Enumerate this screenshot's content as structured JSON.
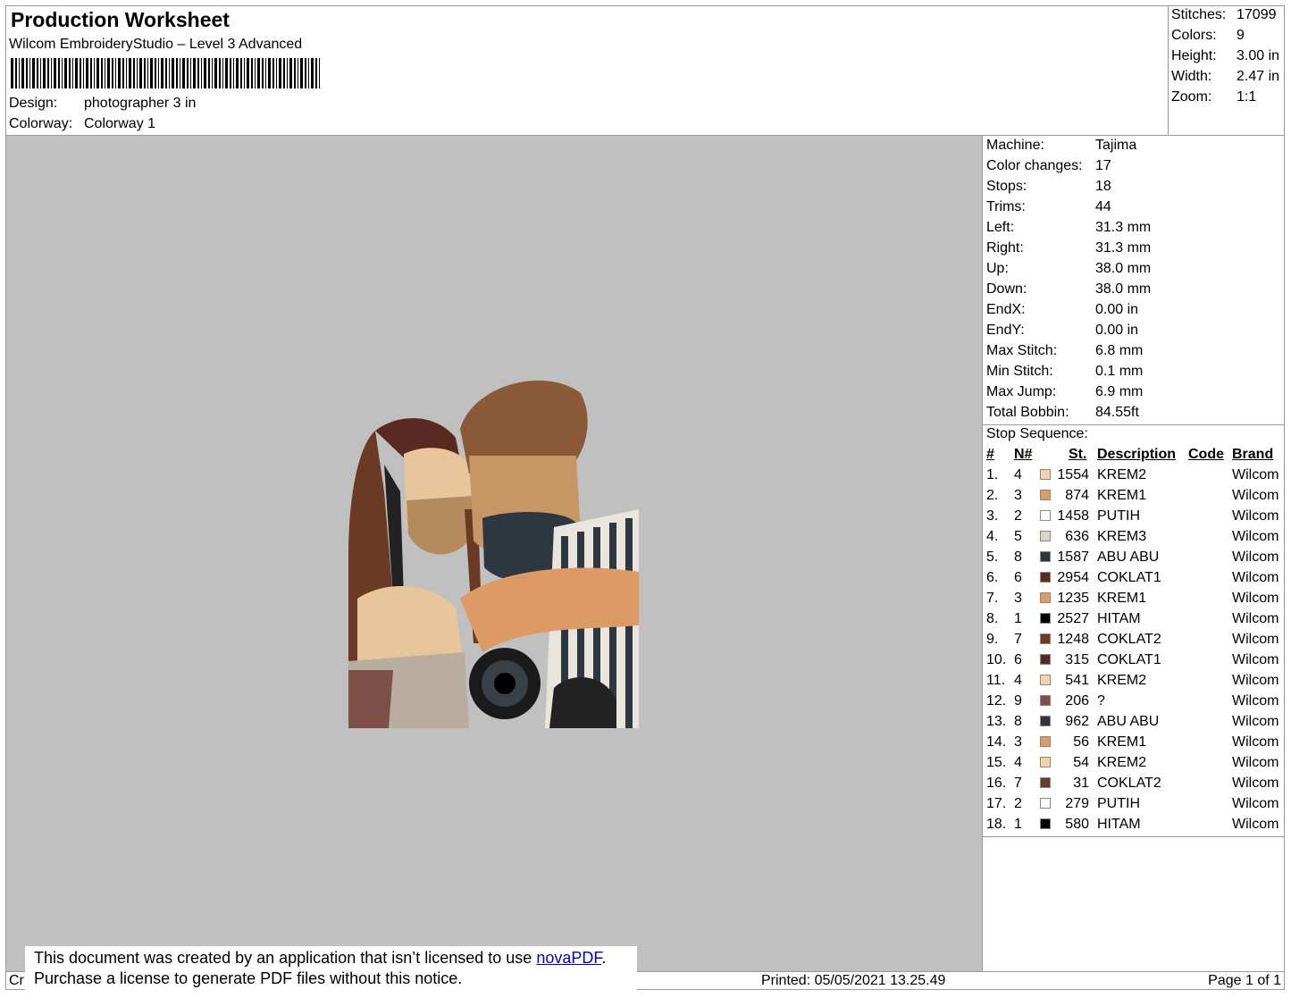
{
  "header": {
    "title": "Production Worksheet",
    "subtitle": "Wilcom EmbroideryStudio – Level 3 Advanced",
    "design_label": "Design:",
    "design_value": "photographer 3 in",
    "colorway_label": "Colorway:",
    "colorway_value": "Colorway 1"
  },
  "stats": [
    {
      "label": "Stitches:",
      "value": "17099"
    },
    {
      "label": "Colors:",
      "value": "9"
    },
    {
      "label": "Height:",
      "value": "3.00 in"
    },
    {
      "label": "Width:",
      "value": "2.47 in"
    },
    {
      "label": "Zoom:",
      "value": "1:1"
    }
  ],
  "machine_info": [
    {
      "label": "Machine:",
      "value": "Tajima"
    },
    {
      "label": "Color changes:",
      "value": "17"
    },
    {
      "label": "Stops:",
      "value": "18"
    },
    {
      "label": "Trims:",
      "value": "44"
    },
    {
      "label": "Left:",
      "value": "31.3 mm"
    },
    {
      "label": "Right:",
      "value": "31.3 mm"
    },
    {
      "label": "Up:",
      "value": "38.0 mm"
    },
    {
      "label": "Down:",
      "value": "38.0 mm"
    },
    {
      "label": "EndX:",
      "value": "0.00 in"
    },
    {
      "label": "EndY:",
      "value": "0.00 in"
    },
    {
      "label": "Max Stitch:",
      "value": "6.8 mm"
    },
    {
      "label": "Min Stitch:",
      "value": "0.1 mm"
    },
    {
      "label": "Max Jump:",
      "value": "6.9 mm"
    },
    {
      "label": "Total Bobbin:",
      "value": "84.55ft"
    }
  ],
  "stop_sequence": {
    "title": "Stop Sequence:",
    "columns": [
      "#",
      "N#",
      "St.",
      "Description",
      "Code",
      "Brand"
    ],
    "rows": [
      {
        "num": "1.",
        "n": "4",
        "color": "#f7d1a4",
        "st": "1554",
        "desc": "KREM2",
        "code": "",
        "brand": "Wilcom"
      },
      {
        "num": "2.",
        "n": "3",
        "color": "#dc9a64",
        "st": "874",
        "desc": "KREM1",
        "code": "",
        "brand": "Wilcom"
      },
      {
        "num": "3.",
        "n": "2",
        "color": "#ffffff",
        "st": "1458",
        "desc": "PUTIH",
        "code": "",
        "brand": "Wilcom"
      },
      {
        "num": "4.",
        "n": "5",
        "color": "#ddd3c6",
        "st": "636",
        "desc": "KREM3",
        "code": "",
        "brand": "Wilcom"
      },
      {
        "num": "5.",
        "n": "8",
        "color": "#2d3740",
        "st": "1587",
        "desc": "ABU ABU",
        "code": "",
        "brand": "Wilcom"
      },
      {
        "num": "6.",
        "n": "6",
        "color": "#5a2a22",
        "st": "2954",
        "desc": "COKLAT1",
        "code": "",
        "brand": "Wilcom"
      },
      {
        "num": "7.",
        "n": "3",
        "color": "#dc9a64",
        "st": "1235",
        "desc": "KREM1",
        "code": "",
        "brand": "Wilcom"
      },
      {
        "num": "8.",
        "n": "1",
        "color": "#000000",
        "st": "2527",
        "desc": "HITAM",
        "code": "",
        "brand": "Wilcom"
      },
      {
        "num": "9.",
        "n": "7",
        "color": "#6b3a24",
        "st": "1248",
        "desc": "COKLAT2",
        "code": "",
        "brand": "Wilcom"
      },
      {
        "num": "10.",
        "n": "6",
        "color": "#5a2a22",
        "st": "315",
        "desc": "COKLAT1",
        "code": "",
        "brand": "Wilcom"
      },
      {
        "num": "11.",
        "n": "4",
        "color": "#f7d1a4",
        "st": "541",
        "desc": "KREM2",
        "code": "",
        "brand": "Wilcom"
      },
      {
        "num": "12.",
        "n": "9",
        "color": "#7d5148",
        "st": "206",
        "desc": "?",
        "code": "",
        "brand": "Wilcom"
      },
      {
        "num": "13.",
        "n": "8",
        "color": "#2d3740",
        "st": "962",
        "desc": "ABU ABU",
        "code": "",
        "brand": "Wilcom"
      },
      {
        "num": "14.",
        "n": "3",
        "color": "#dc9a64",
        "st": "56",
        "desc": "KREM1",
        "code": "",
        "brand": "Wilcom"
      },
      {
        "num": "15.",
        "n": "4",
        "color": "#f7d1a4",
        "st": "54",
        "desc": "KREM2",
        "code": "",
        "brand": "Wilcom"
      },
      {
        "num": "16.",
        "n": "7",
        "color": "#6b3a24",
        "st": "31",
        "desc": "COKLAT2",
        "code": "",
        "brand": "Wilcom"
      },
      {
        "num": "17.",
        "n": "2",
        "color": "#ffffff",
        "st": "279",
        "desc": "PUTIH",
        "code": "",
        "brand": "Wilcom"
      },
      {
        "num": "18.",
        "n": "1",
        "color": "#000000",
        "st": "580",
        "desc": "HITAM",
        "code": "",
        "brand": "Wilcom"
      }
    ]
  },
  "footer": {
    "left_text": "Cr",
    "printed": "Printed: 05/05/2021 13.25.49",
    "page": "Page 1 of 1"
  },
  "notice": {
    "line1_before": "This document was created by an application that isn’t licensed to use ",
    "link": "novaPDF",
    "line1_after": ".",
    "line2": "Purchase a license to generate PDF files without this notice."
  }
}
